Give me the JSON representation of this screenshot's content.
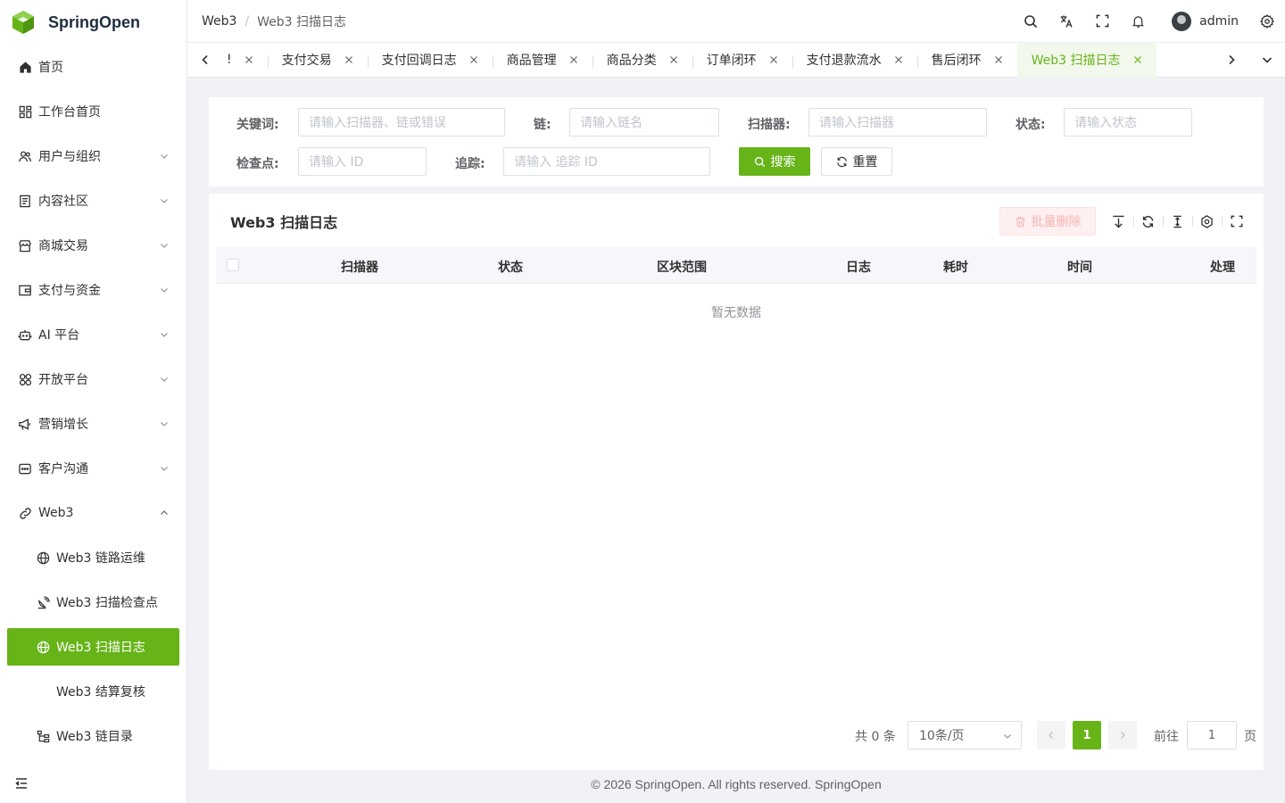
{
  "brand": {
    "name": "SpringOpen",
    "color": "#67b419"
  },
  "sidebar": {
    "items": [
      {
        "label": "首页",
        "icon": "home-icon",
        "expandable": false
      },
      {
        "label": "工作台首页",
        "icon": "dashboard-icon",
        "expandable": false
      },
      {
        "label": "用户与组织",
        "icon": "users-icon",
        "expandable": true
      },
      {
        "label": "内容社区",
        "icon": "document-icon",
        "expandable": true
      },
      {
        "label": "商城交易",
        "icon": "store-icon",
        "expandable": true
      },
      {
        "label": "支付与资金",
        "icon": "wallet-icon",
        "expandable": true
      },
      {
        "label": "AI 平台",
        "icon": "robot-icon",
        "expandable": true
      },
      {
        "label": "开放平台",
        "icon": "grid-icon",
        "expandable": true
      },
      {
        "label": "营销增长",
        "icon": "megaphone-icon",
        "expandable": true
      },
      {
        "label": "客户沟通",
        "icon": "chat-icon",
        "expandable": true
      },
      {
        "label": "Web3",
        "icon": "link-icon",
        "expandable": true,
        "expanded": true
      }
    ],
    "sub_items": [
      {
        "label": "Web3 链路运维",
        "icon": "globe-icon"
      },
      {
        "label": "Web3 扫描检查点",
        "icon": "satellite-icon"
      },
      {
        "label": "Web3 扫描日志",
        "icon": "globe-icon",
        "active": true
      },
      {
        "label": "Web3 结算复核",
        "icon": ""
      },
      {
        "label": "Web3 链目录",
        "icon": "tree-icon"
      }
    ]
  },
  "header": {
    "breadcrumb": [
      "Web3",
      "Web3 扫描日志"
    ],
    "username": "admin"
  },
  "tabs": {
    "items": [
      {
        "label": "!",
        "active": false
      },
      {
        "label": "支付交易",
        "active": false
      },
      {
        "label": "支付回调日志",
        "active": false
      },
      {
        "label": "商品管理",
        "active": false
      },
      {
        "label": "商品分类",
        "active": false
      },
      {
        "label": "订单闭环",
        "active": false
      },
      {
        "label": "支付退款流水",
        "active": false
      },
      {
        "label": "售后闭环",
        "active": false
      },
      {
        "label": "Web3 扫描日志",
        "active": true
      }
    ]
  },
  "search": {
    "keyword_label": "关键词:",
    "keyword_placeholder": "请输入扫描器、链或错误",
    "chain_label": "链:",
    "chain_placeholder": "请输入链名",
    "scanner_label": "扫描器:",
    "scanner_placeholder": "请输入扫描器",
    "status_label": "状态:",
    "status_placeholder": "请输入状态",
    "checkpoint_label": "检查点:",
    "checkpoint_placeholder": "请输入 ID",
    "trace_label": "追踪:",
    "trace_placeholder": "请输入 追踪 ID",
    "search_button": "搜索",
    "reset_button": "重置"
  },
  "table": {
    "title": "Web3 扫描日志",
    "batch_delete": "批量删除",
    "columns": [
      "扫描器",
      "状态",
      "区块范围",
      "日志",
      "耗时",
      "时间",
      "处理"
    ],
    "rows": [],
    "empty_text": "暂无数据"
  },
  "pagination": {
    "total_text": "共 0 条",
    "page_size": "10条/页",
    "current_page": "1",
    "goto_label": "前往",
    "goto_value": "1",
    "page_suffix": "页"
  },
  "footer": {
    "text": "© 2026 SpringOpen. All rights reserved. SpringOpen"
  }
}
